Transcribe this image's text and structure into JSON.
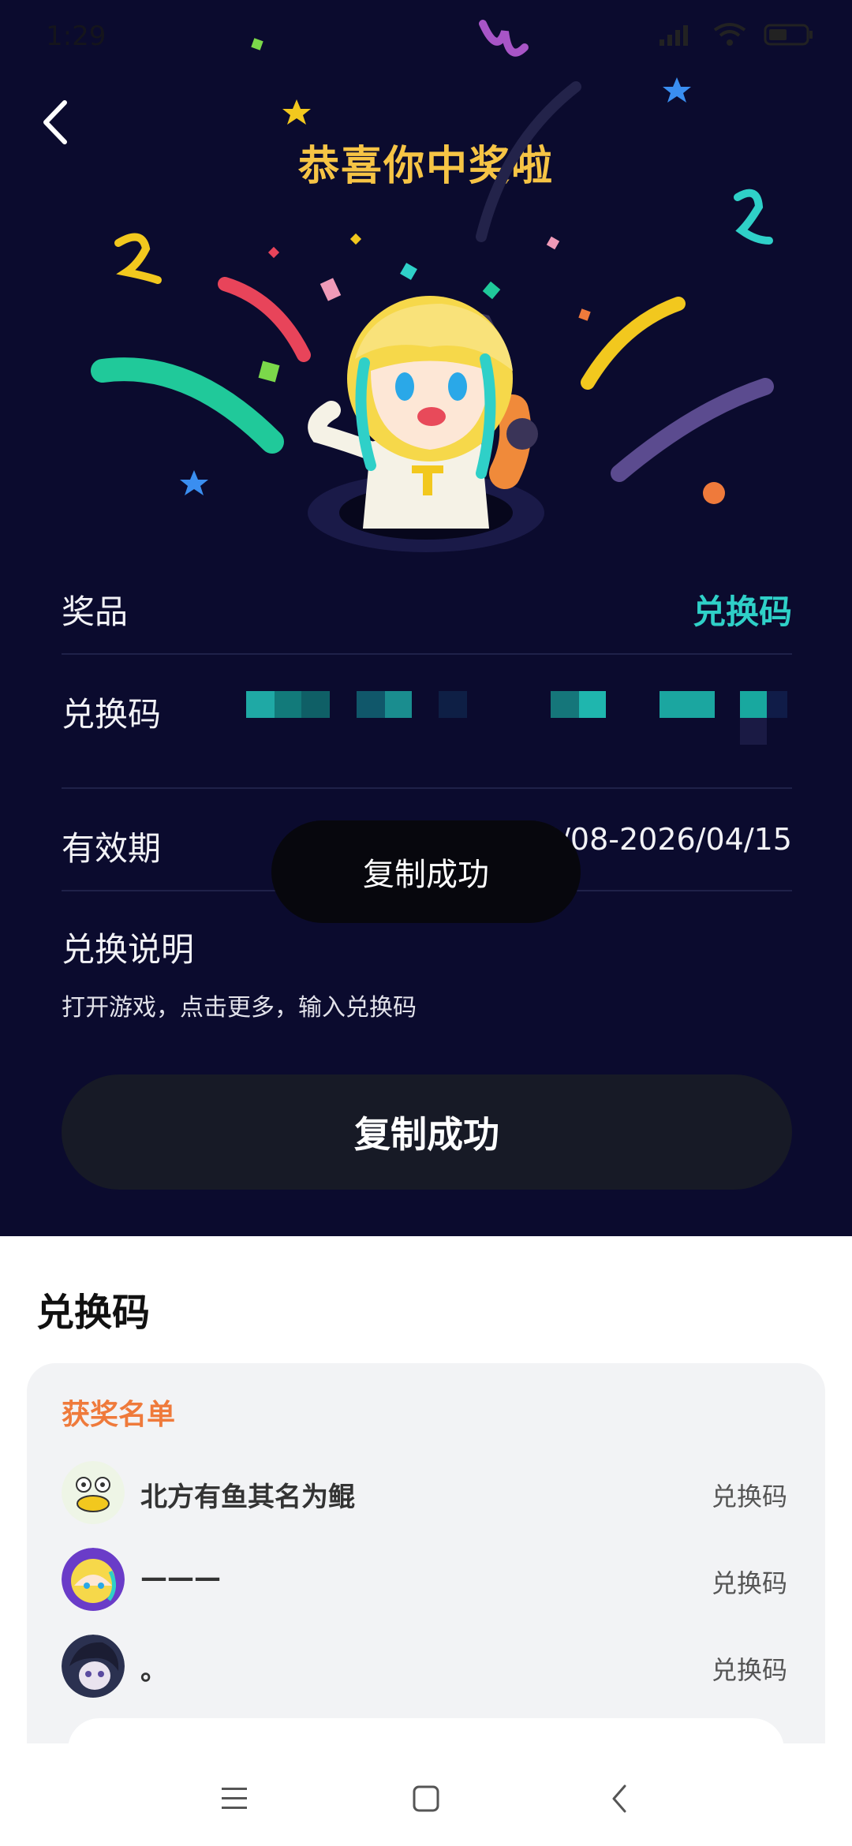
{
  "status": {
    "time": "1:29"
  },
  "header": {
    "title": "恭喜你中奖啦"
  },
  "details": {
    "prize_label": "奖品",
    "prize_value": "兑换码",
    "code_label": "兑换码",
    "validity_label": "有效期",
    "validity_value": "2026/04/08-2026/04/15",
    "instructions_label": "兑换说明",
    "instructions_text": "打开游戏，点击更多，输入兑换码"
  },
  "toast": {
    "text": "复制成功"
  },
  "copy_button": {
    "label": "复制成功"
  },
  "sheet": {
    "title": "兑换码",
    "winners_title": "获奖名单",
    "winners": [
      {
        "name": "北方有鱼其名为鲲",
        "prize": "兑换码"
      },
      {
        "name": "———",
        "prize": "兑换码"
      },
      {
        "name": "。",
        "prize": "兑换码"
      }
    ]
  },
  "colors": {
    "background_dark": "#0b0b2e",
    "headline": "#f6c445",
    "accent_teal": "#2fd0c8",
    "winners_title": "#ef7a3b"
  }
}
